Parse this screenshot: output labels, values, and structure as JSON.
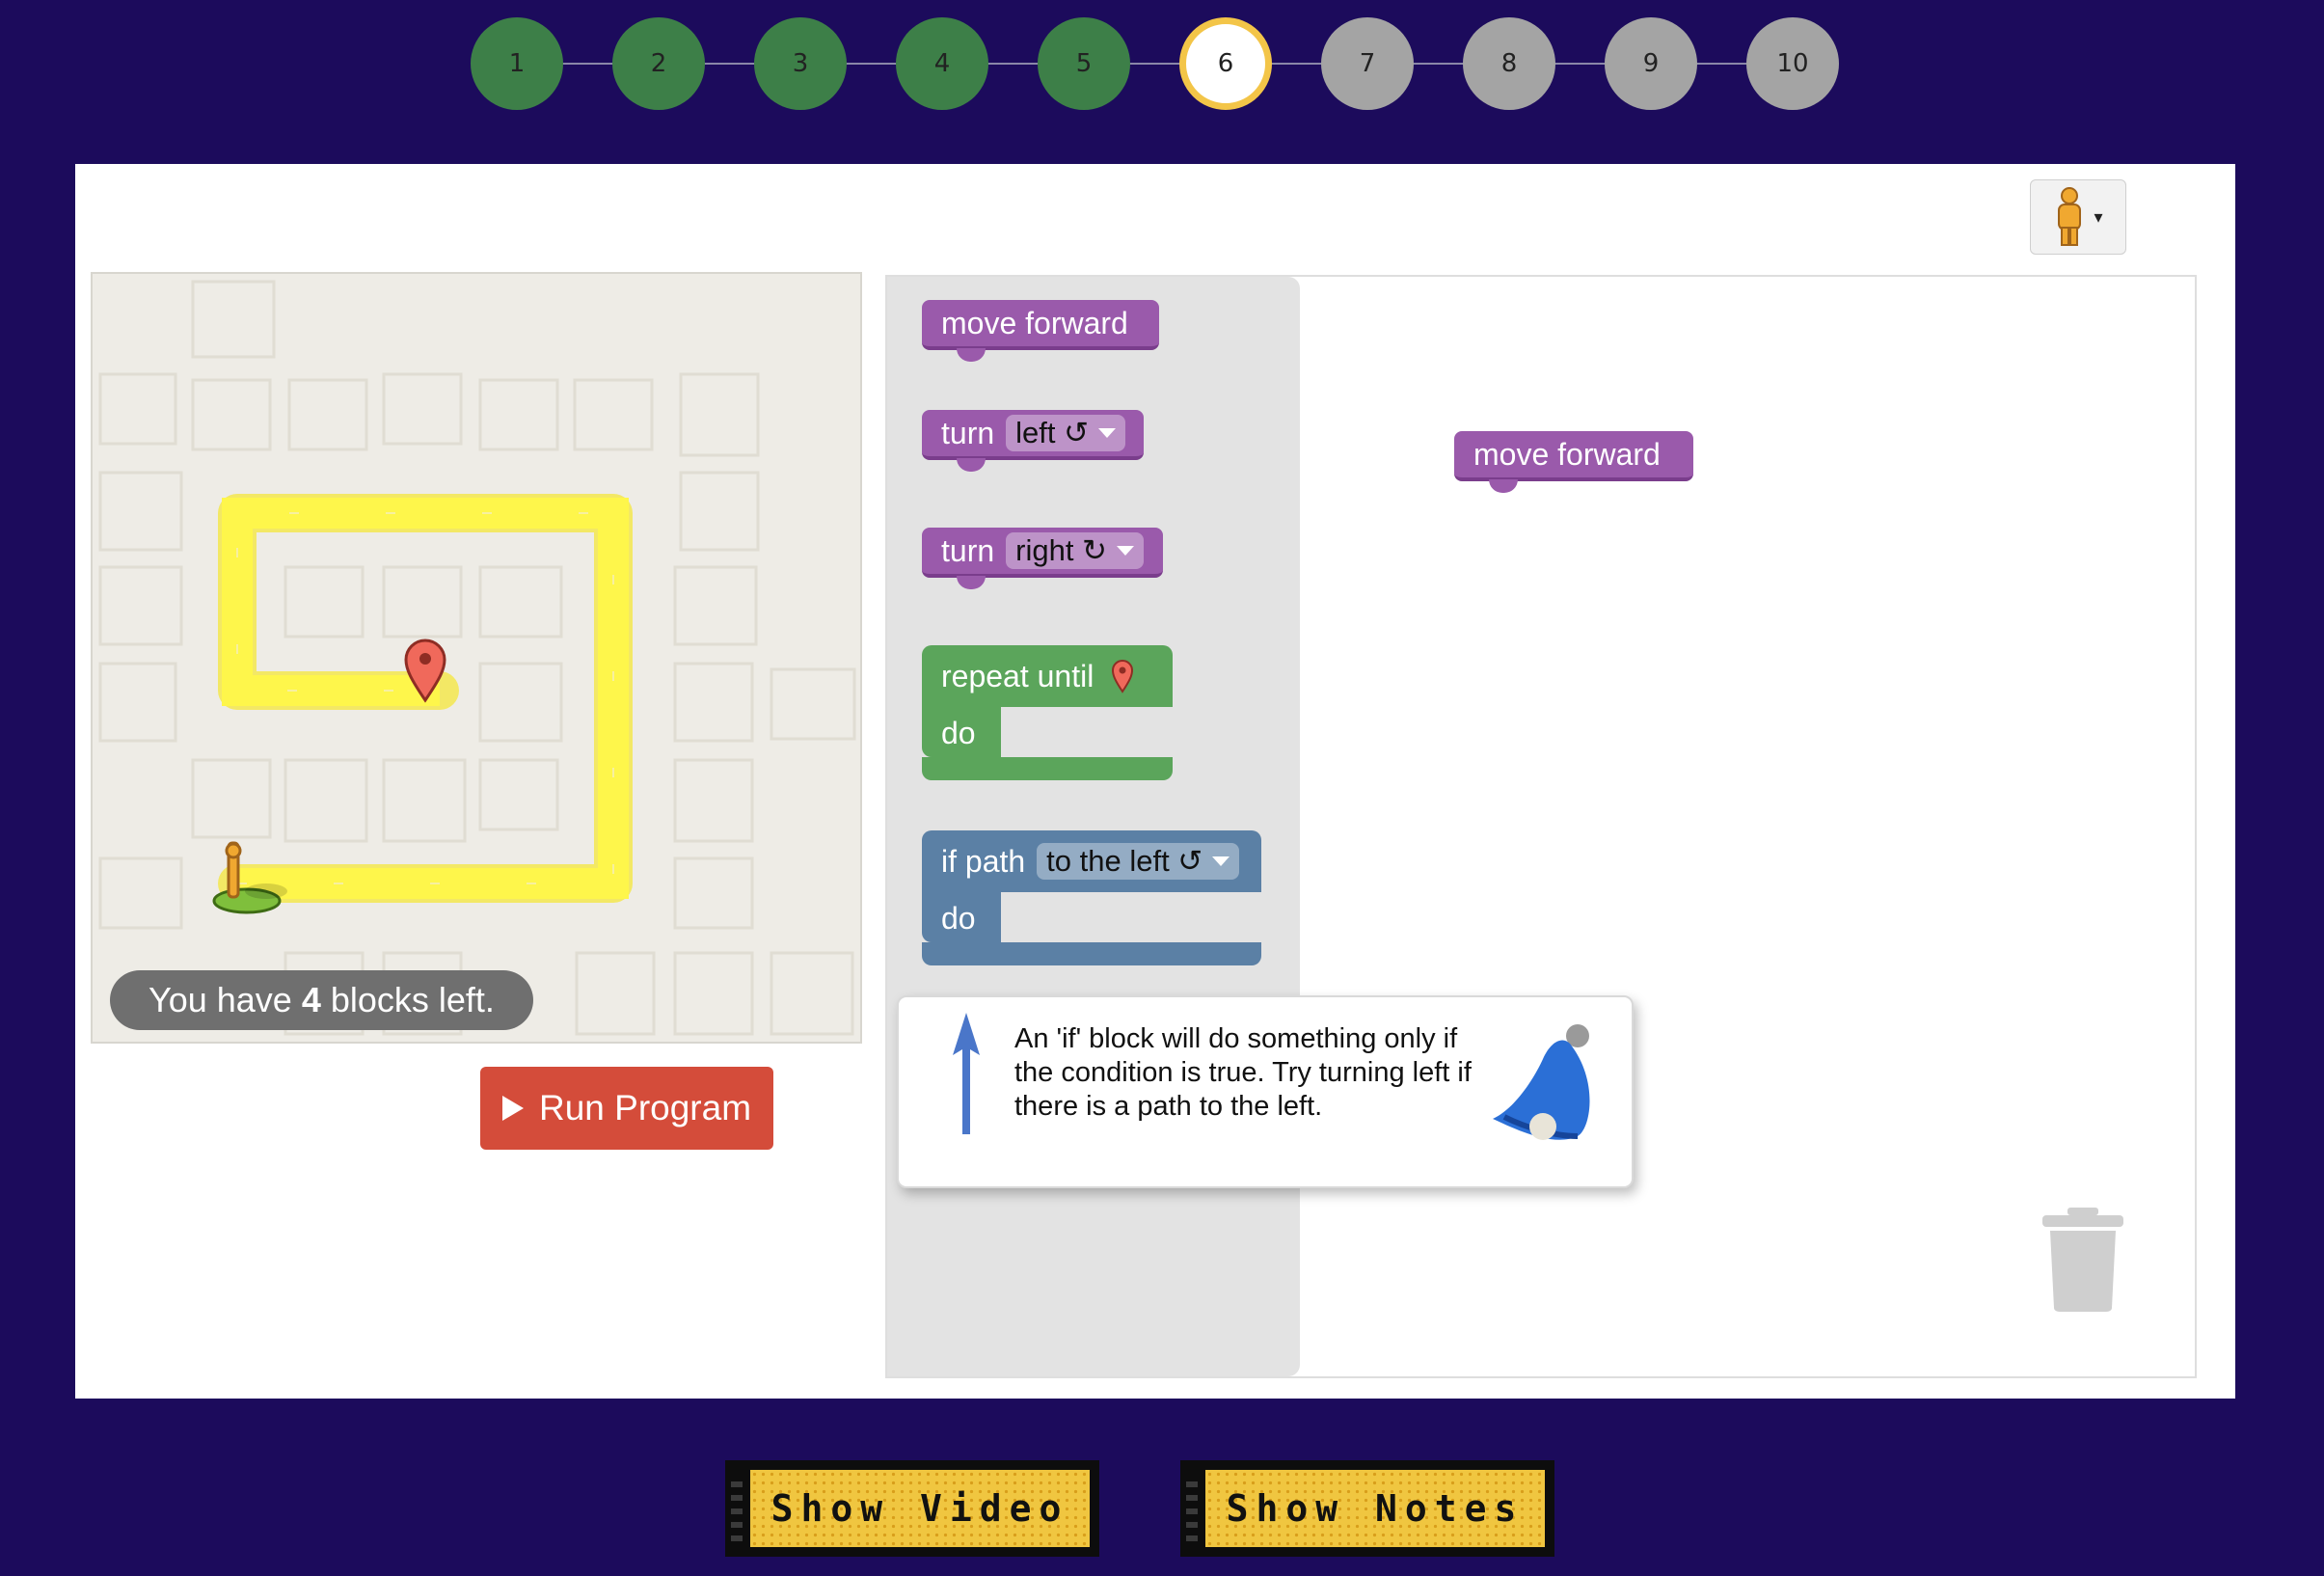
{
  "levels": {
    "items": [
      {
        "label": "1",
        "status": "done"
      },
      {
        "label": "2",
        "status": "done"
      },
      {
        "label": "3",
        "status": "done"
      },
      {
        "label": "4",
        "status": "done"
      },
      {
        "label": "5",
        "status": "done"
      },
      {
        "label": "6",
        "status": "current"
      },
      {
        "label": "7",
        "status": "todo"
      },
      {
        "label": "8",
        "status": "todo"
      },
      {
        "label": "9",
        "status": "todo"
      },
      {
        "label": "10",
        "status": "todo"
      }
    ],
    "colors": {
      "done": "#3d7f48",
      "current_ring": "#f3c548",
      "todo": "#a4a4a4"
    }
  },
  "avatar": {
    "icon": "pegman-icon",
    "caret": "▾"
  },
  "maze": {
    "blocks_left_prefix": "You have ",
    "blocks_left_count": "4",
    "blocks_left_suffix": " blocks left.",
    "path_color": "#fef64b",
    "start_icon": "pegman-icon",
    "goal_icon": "map-marker-icon"
  },
  "run_button": {
    "label": "Run Program",
    "color": "#d44c3a"
  },
  "toolbox": {
    "move_forward": "move forward",
    "turn_left": {
      "label": "turn",
      "option": "left ↺"
    },
    "turn_right": {
      "label": "turn",
      "option": "right ↻"
    },
    "repeat_until": {
      "label": "repeat until",
      "do": "do"
    },
    "if_path": {
      "label": "if path",
      "option": "to the left ↺",
      "do": "do"
    }
  },
  "workspace": {
    "placed_block": "move forward"
  },
  "hint": {
    "text": "An 'if' block will do something only if the condition is true. Try turning left if there is a path to the left."
  },
  "bottom_buttons": {
    "video": "Show Video",
    "notes": "Show Notes"
  },
  "colors": {
    "background": "#1c0b5c",
    "motion_block": "#9a5aab",
    "loop_block": "#5ba55b",
    "logic_block": "#5b80a5"
  }
}
